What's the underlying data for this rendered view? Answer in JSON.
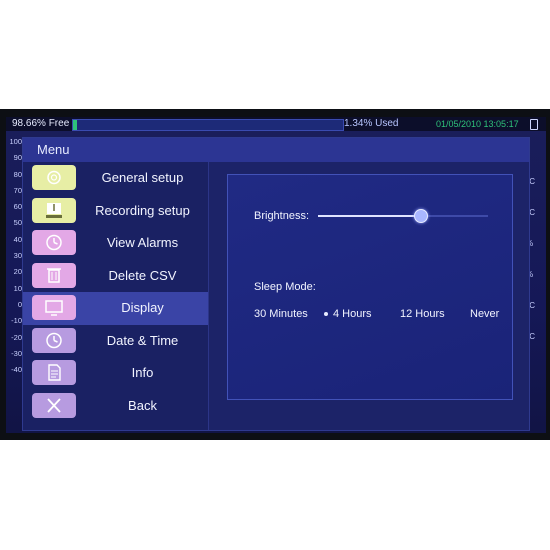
{
  "status": {
    "free": "98.66% Free",
    "used": "1.34% Used",
    "used_fraction": 0.0134,
    "datetime": "01/05/2010 13:05:17"
  },
  "scale": [
    "100",
    "90",
    "80",
    "70",
    "60",
    "50",
    "40",
    "30",
    "20",
    "10",
    "0",
    "-10",
    "-20",
    "-30",
    "-40"
  ],
  "units": [
    "°C",
    "°C",
    "%",
    "%",
    "°C",
    "°C"
  ],
  "menu": {
    "title": "Menu",
    "items": [
      {
        "label": "General setup",
        "icon": "gear-icon",
        "color": "#e7eea5"
      },
      {
        "label": "Recording setup",
        "icon": "record-icon",
        "color": "#e7eea5"
      },
      {
        "label": "View Alarms",
        "icon": "clock-icon",
        "color": "#e3a8e6"
      },
      {
        "label": "Delete CSV",
        "icon": "trash-icon",
        "color": "#e3a8e6"
      },
      {
        "label": "Display",
        "icon": "monitor-icon",
        "color": "#e3a8e6"
      },
      {
        "label": "Date & Time",
        "icon": "clock-icon",
        "color": "#b79be0"
      },
      {
        "label": "Info",
        "icon": "document-icon",
        "color": "#b79be0"
      },
      {
        "label": "Back",
        "icon": "close-icon",
        "color": "#b79be0"
      }
    ],
    "active_index": 4
  },
  "display": {
    "brightness_label": "Brightness:",
    "brightness_value": 0.6,
    "sleep_label": "Sleep Mode:",
    "sleep_options": [
      "30 Minutes",
      "4 Hours",
      "12 Hours",
      "Never"
    ],
    "sleep_selected": 1
  },
  "colors": {
    "accent": "#3a44a6",
    "panel": "#1c2368",
    "status_green": "#2ec27a"
  }
}
